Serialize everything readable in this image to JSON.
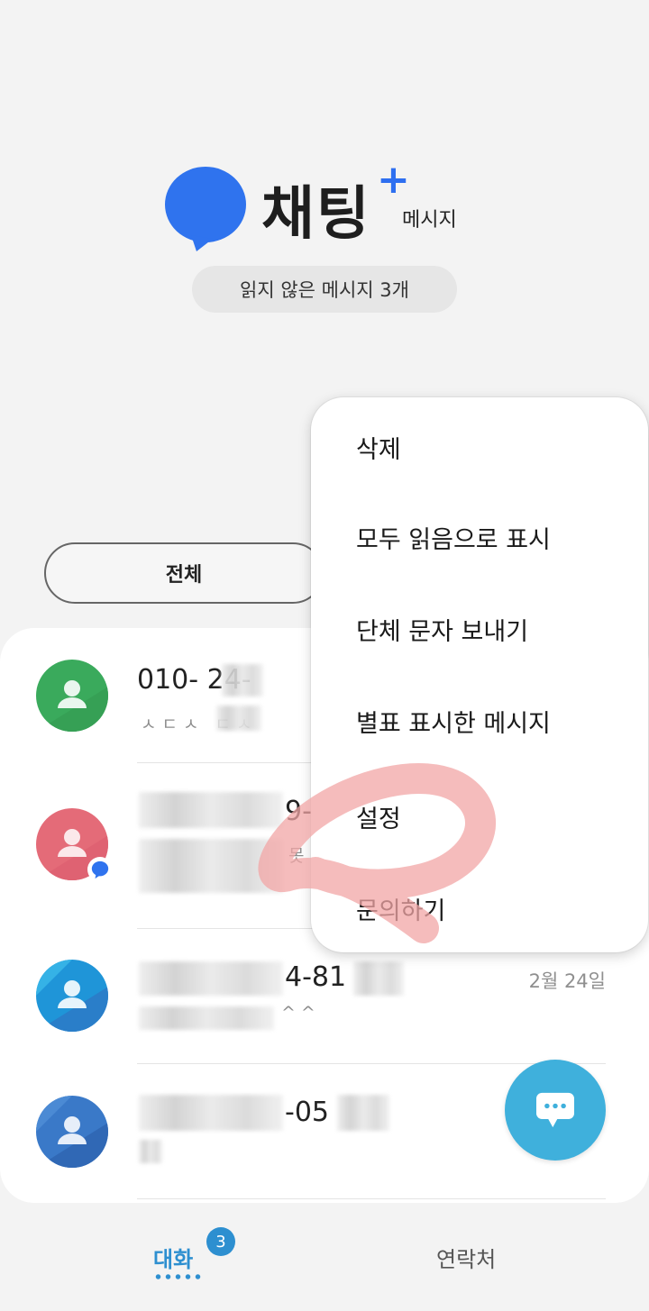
{
  "header": {
    "title": "채팅",
    "title_plus": "+",
    "subtitle": "메시지",
    "unread_summary": "읽지 않은 메시지 3개",
    "brand_color": "#2f73ee"
  },
  "filter": {
    "label": "전체"
  },
  "conversations": [
    {
      "title": "010-  24-",
      "preview": "ㅅㄷㅅ ㄷㅅ",
      "avatar_color": "#3aaa5c",
      "unread": false,
      "date": ""
    },
    {
      "title": "9-",
      "preview": "못",
      "avatar_color": "#e46b78",
      "unread": true,
      "date": ""
    },
    {
      "title": "4-81",
      "preview": "^^",
      "avatar_color": "#1f95d8",
      "unread": false,
      "date": "2월 24일"
    },
    {
      "title": "-05",
      "preview": "",
      "avatar_color": "#3a79c8",
      "unread": false,
      "date": ""
    }
  ],
  "menu": {
    "items": [
      "삭제",
      "모두 읽음으로 표시",
      "단체 문자 보내기",
      "별표 표시한 메시지",
      "설정",
      "문의하기"
    ]
  },
  "fab": {
    "icon": "chat-compose-icon",
    "color": "#3fb0dc"
  },
  "bottom_nav": {
    "tabs": [
      "대화",
      "연락처"
    ],
    "badge": "3",
    "active_color": "#2d8fd0"
  }
}
